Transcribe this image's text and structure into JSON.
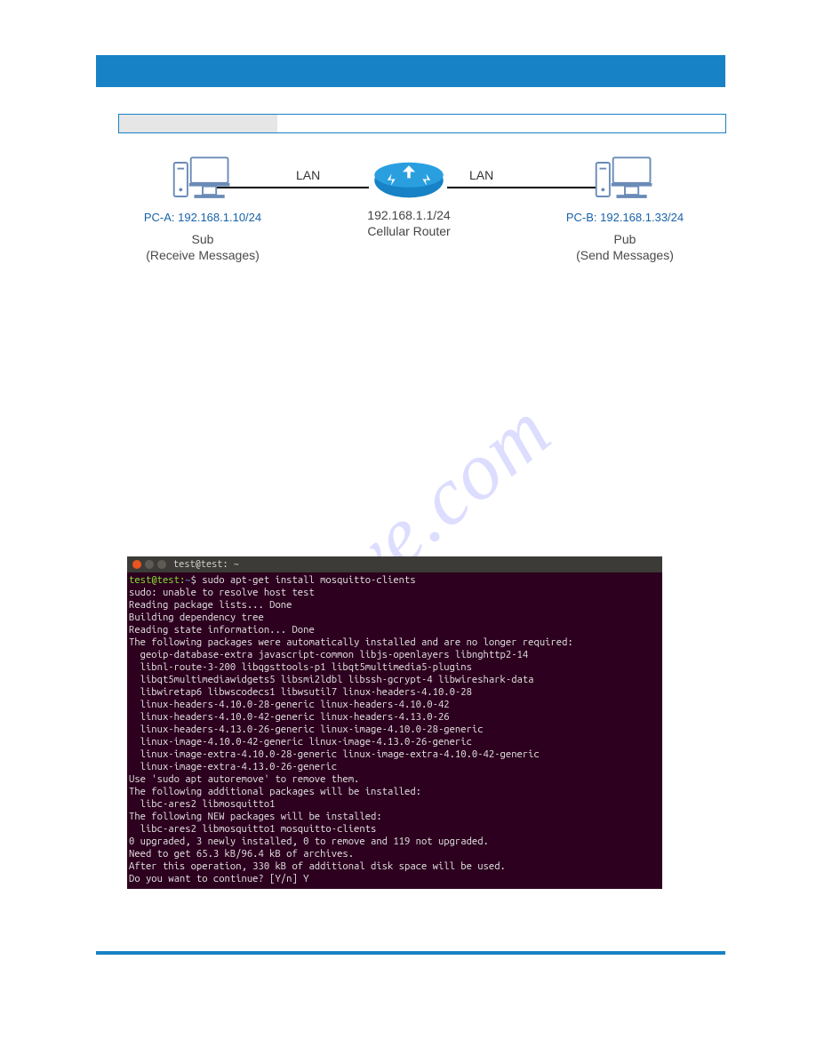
{
  "watermark": "shive.com",
  "diagram": {
    "pc_a": {
      "ip": "PC-A: 192.168.1.10/24",
      "role_title": "Sub",
      "role_sub": "(Receive Messages)"
    },
    "router": {
      "ip": "192.168.1.1/24",
      "name": "Cellular Router"
    },
    "pc_b": {
      "ip": "PC-B: 192.168.1.33/24",
      "role_title": "Pub",
      "role_sub": "(Send Messages)"
    },
    "lan_left": "LAN",
    "lan_right": "LAN"
  },
  "terminal": {
    "title": "test@test: ~",
    "prompt_user": "test@test",
    "prompt_path": "~",
    "command": "sudo apt-get install mosquitto-clients",
    "output": "sudo: unable to resolve host test\nReading package lists... Done\nBuilding dependency tree\nReading state information... Done\nThe following packages were automatically installed and are no longer required:\n  geoip-database-extra javascript-common libjs-openlayers libnghttp2-14\n  libnl-route-3-200 libqgsttools-p1 libqt5multimedia5-plugins\n  libqt5multimediawidgets5 libsmi2ldbl libssh-gcrypt-4 libwireshark-data\n  libwiretap6 libwscodecs1 libwsutil7 linux-headers-4.10.0-28\n  linux-headers-4.10.0-28-generic linux-headers-4.10.0-42\n  linux-headers-4.10.0-42-generic linux-headers-4.13.0-26\n  linux-headers-4.13.0-26-generic linux-image-4.10.0-28-generic\n  linux-image-4.10.0-42-generic linux-image-4.13.0-26-generic\n  linux-image-extra-4.10.0-28-generic linux-image-extra-4.10.0-42-generic\n  linux-image-extra-4.13.0-26-generic\nUse 'sudo apt autoremove' to remove them.\nThe following additional packages will be installed:\n  libc-ares2 libmosquitto1\nThe following NEW packages will be installed:\n  libc-ares2 libmosquitto1 mosquitto-clients\n0 upgraded, 3 newly installed, 0 to remove and 119 not upgraded.\nNeed to get 65.3 kB/96.4 kB of archives.\nAfter this operation, 330 kB of additional disk space will be used.\nDo you want to continue? [Y/n] Y"
  }
}
